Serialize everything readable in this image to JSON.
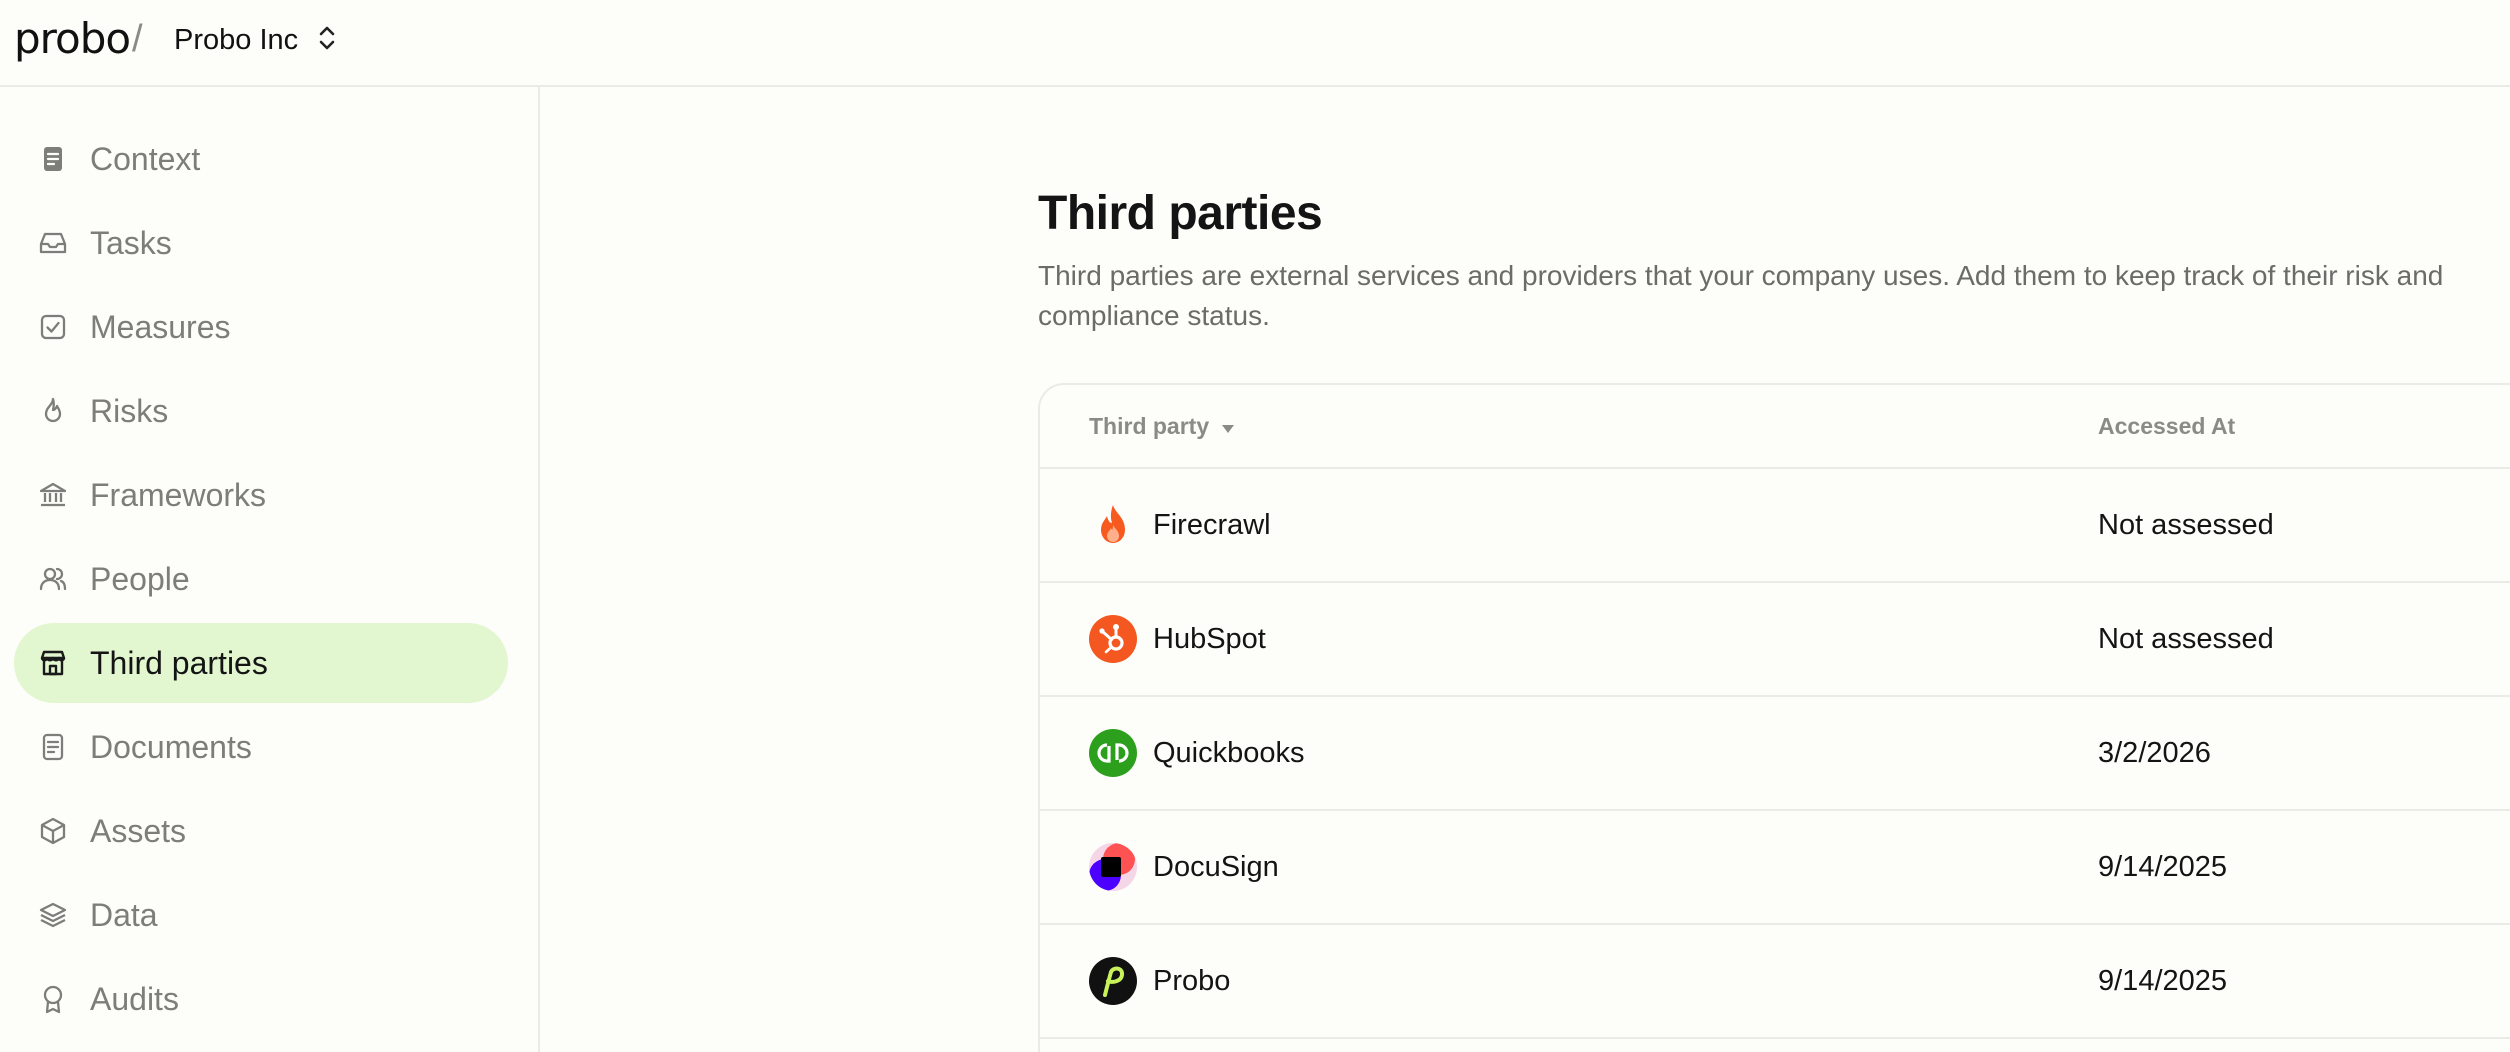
{
  "header": {
    "logo_text": "probo",
    "separator": "/",
    "org_name": "Probo Inc"
  },
  "sidebar": {
    "items": [
      {
        "label": "Context",
        "icon": "document-icon",
        "active": false
      },
      {
        "label": "Tasks",
        "icon": "inbox-icon",
        "active": false
      },
      {
        "label": "Measures",
        "icon": "check-square-icon",
        "active": false
      },
      {
        "label": "Risks",
        "icon": "flame-icon",
        "active": false
      },
      {
        "label": "Frameworks",
        "icon": "bank-icon",
        "active": false
      },
      {
        "label": "People",
        "icon": "users-icon",
        "active": false
      },
      {
        "label": "Third parties",
        "icon": "storefront-icon",
        "active": true
      },
      {
        "label": "Documents",
        "icon": "file-text-icon",
        "active": false
      },
      {
        "label": "Assets",
        "icon": "cube-icon",
        "active": false
      },
      {
        "label": "Data",
        "icon": "layers-icon",
        "active": false
      },
      {
        "label": "Audits",
        "icon": "award-icon",
        "active": false
      }
    ]
  },
  "main": {
    "title": "Third parties",
    "description": "Third parties are external services and providers that your company uses. Add them to keep track of their risk and compliance status.",
    "table": {
      "columns": [
        "Third party",
        "Accessed At"
      ],
      "rows": [
        {
          "name": "Firecrawl",
          "accessed_at": "Not assessed",
          "logo": "firecrawl-logo-icon"
        },
        {
          "name": "HubSpot",
          "accessed_at": "Not assessed",
          "logo": "hubspot-logo-icon"
        },
        {
          "name": "Quickbooks",
          "accessed_at": "3/2/2026",
          "logo": "quickbooks-logo-icon"
        },
        {
          "name": "DocuSign",
          "accessed_at": "9/14/2025",
          "logo": "docusign-logo-icon"
        },
        {
          "name": "Probo",
          "accessed_at": "9/14/2025",
          "logo": "probo-logo-icon"
        }
      ]
    }
  },
  "colors": {
    "background": "#fdfdfa",
    "active_nav_bg": "#e2f6cf",
    "border": "#ebebe6",
    "muted_text": "#7d7d79"
  }
}
